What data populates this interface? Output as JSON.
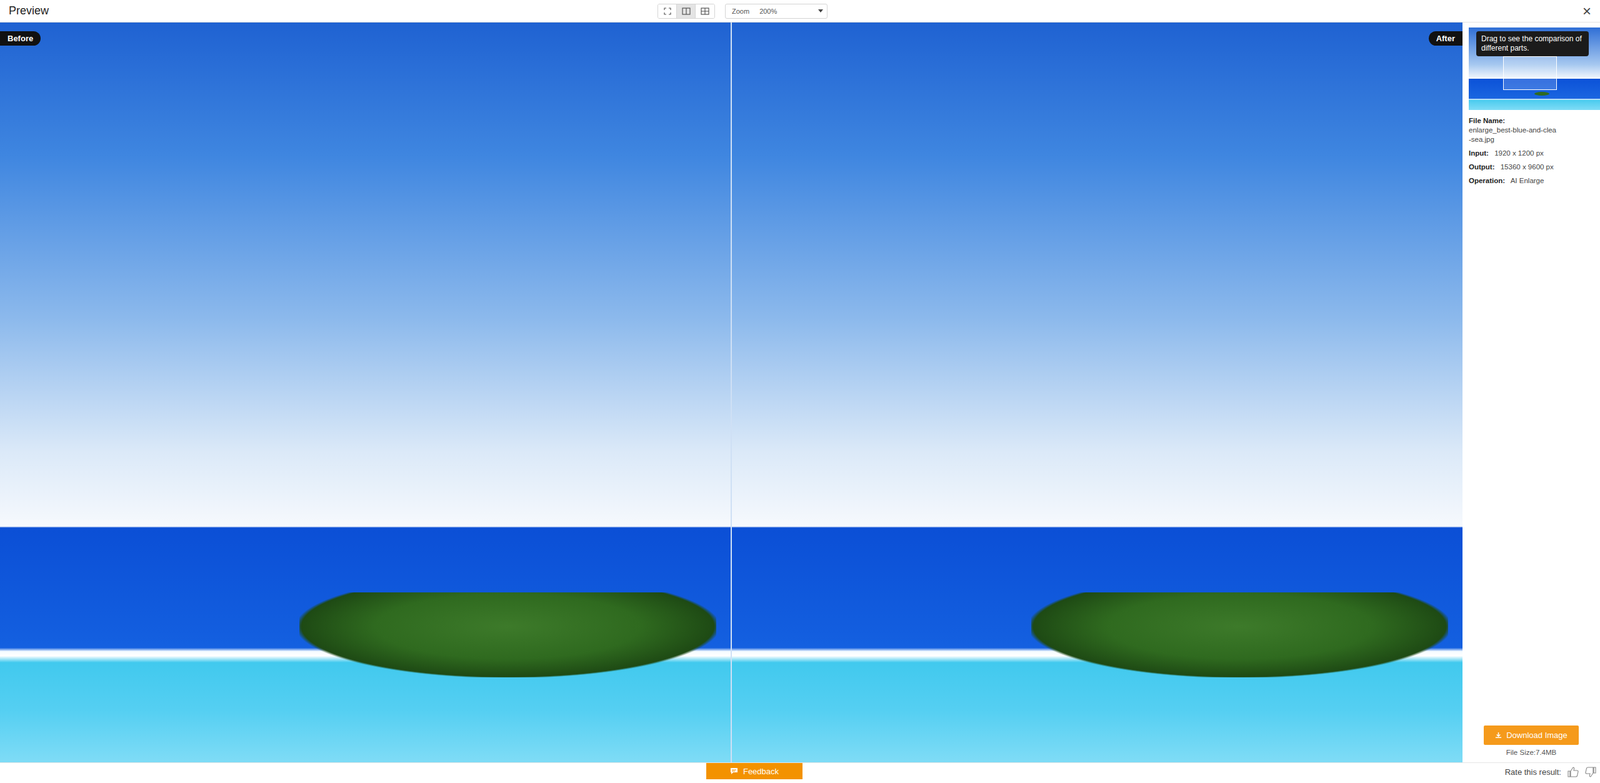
{
  "window": {
    "title": "Preview",
    "close": "×"
  },
  "toolbar": {
    "views": [
      {
        "kind": "fit",
        "selected": false
      },
      {
        "kind": "split",
        "selected": true
      },
      {
        "kind": "grid",
        "selected": false
      }
    ],
    "zoom_label": "Zoom",
    "zoom_value": "200%"
  },
  "panels": [
    {
      "badge": "Before",
      "side": "left"
    },
    {
      "badge": "After",
      "side": "right"
    }
  ],
  "sidebar": {
    "tooltip": "Drag to see the comparison of different parts.",
    "fields": [
      {
        "label": "File Name:",
        "lines": [
          "enlarge_best-blue-and-clea",
          "-sea.jpg"
        ]
      },
      {
        "label": "Input:",
        "lines": [
          "1920 x 1200 px"
        ]
      },
      {
        "label": "Output:",
        "lines": [
          "15360 x 9600 px"
        ]
      },
      {
        "label": "Operation:",
        "lines": [
          "AI Enlarge"
        ]
      }
    ],
    "download": "Download Image",
    "file_size": "File Size:7.4MB"
  },
  "footer": {
    "feedback": "Feedback",
    "rate_label": "Rate this result:"
  }
}
